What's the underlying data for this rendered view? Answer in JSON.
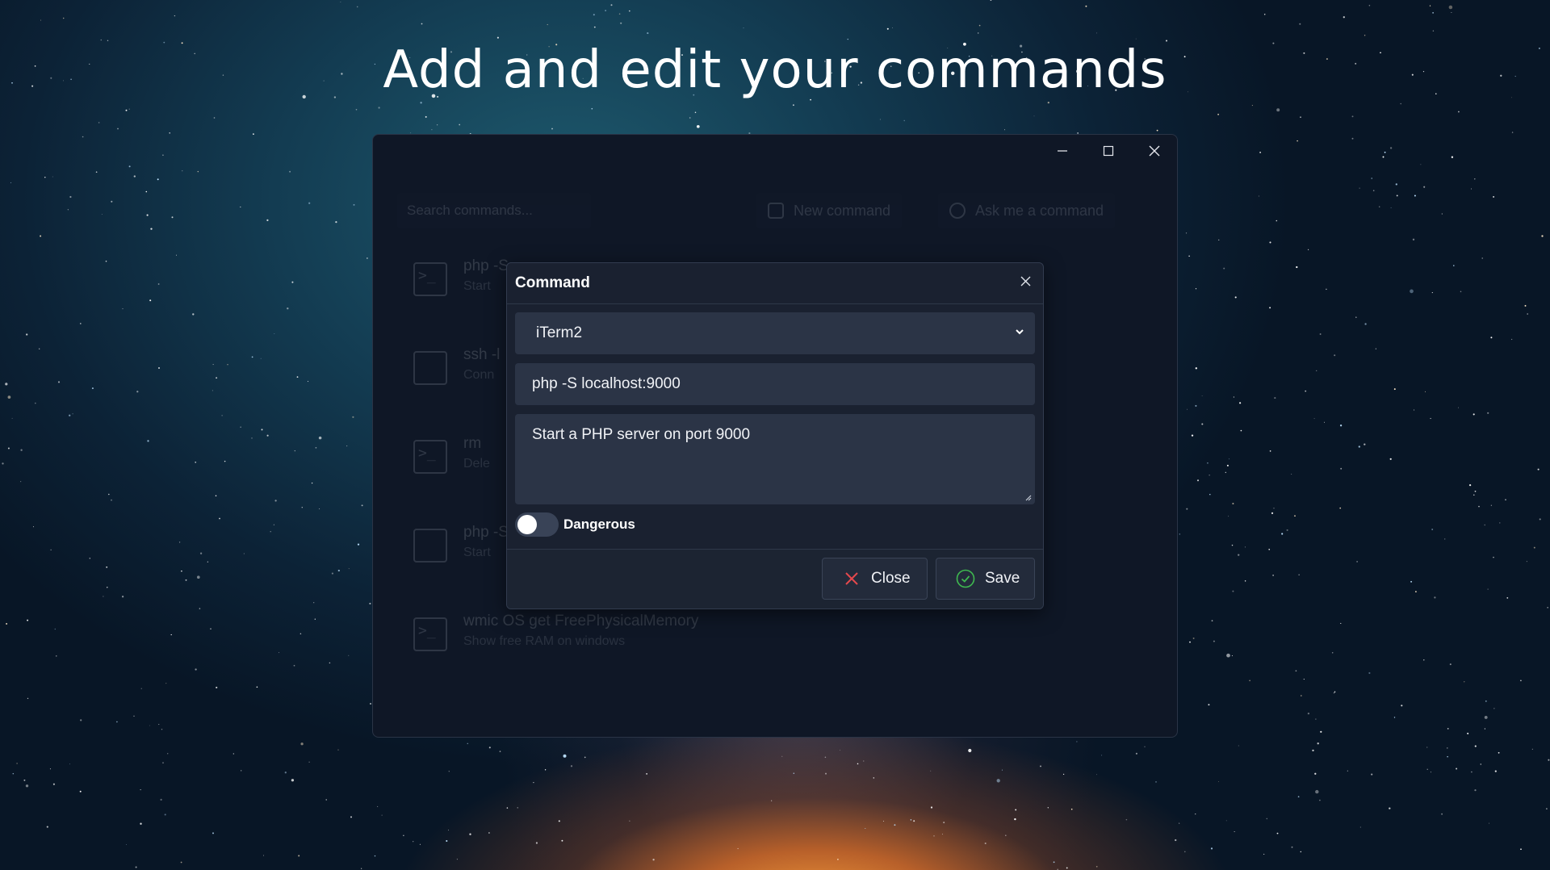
{
  "headline": "Add and edit your commands",
  "window": {
    "controls": {
      "minimize": "minimize-icon",
      "maximize": "maximize-icon",
      "close": "close-icon"
    }
  },
  "background_app": {
    "search_placeholder": "Search commands...",
    "new_command_label": "New command",
    "ask_label": "Ask me a command",
    "rows": [
      {
        "command": "php -S",
        "description": "Start"
      },
      {
        "command": "ssh -l",
        "description": "Conn"
      },
      {
        "command": "rm",
        "description": "Dele"
      },
      {
        "command": "php -S",
        "description": "Start"
      },
      {
        "command": "wmic OS get FreePhysicalMemory",
        "description": "Show free RAM on windows"
      }
    ]
  },
  "dialog": {
    "title": "Command",
    "terminal_select": {
      "value": "iTerm2"
    },
    "command_input": {
      "value": "php -S localhost:9000"
    },
    "description_input": {
      "value": "Start a PHP server on port 9000"
    },
    "dangerous_toggle": {
      "label": "Dangerous",
      "checked": false
    },
    "close_button": {
      "label": "Close",
      "icon": "x-icon",
      "color": "#e5484d"
    },
    "save_button": {
      "label": "Save",
      "icon": "check-circle-icon",
      "color": "#3fb950"
    }
  }
}
